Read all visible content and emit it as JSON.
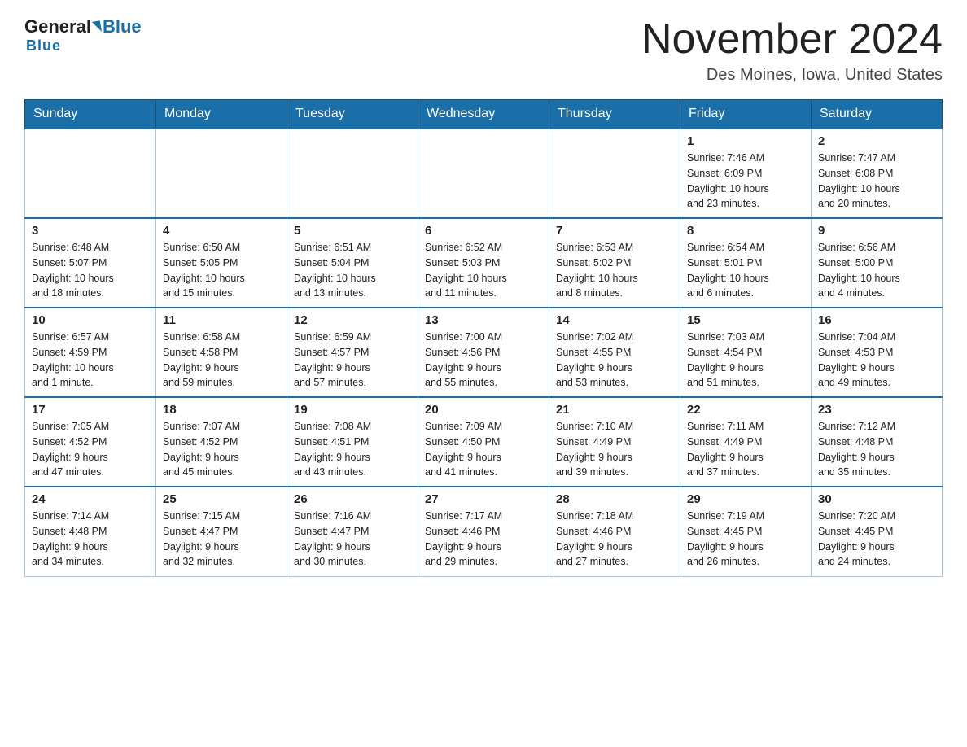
{
  "header": {
    "logo_general": "General",
    "logo_blue": "Blue",
    "month_title": "November 2024",
    "location": "Des Moines, Iowa, United States"
  },
  "days_of_week": [
    "Sunday",
    "Monday",
    "Tuesday",
    "Wednesday",
    "Thursday",
    "Friday",
    "Saturday"
  ],
  "weeks": [
    {
      "days": [
        {
          "number": "",
          "info": ""
        },
        {
          "number": "",
          "info": ""
        },
        {
          "number": "",
          "info": ""
        },
        {
          "number": "",
          "info": ""
        },
        {
          "number": "",
          "info": ""
        },
        {
          "number": "1",
          "info": "Sunrise: 7:46 AM\nSunset: 6:09 PM\nDaylight: 10 hours\nand 23 minutes."
        },
        {
          "number": "2",
          "info": "Sunrise: 7:47 AM\nSunset: 6:08 PM\nDaylight: 10 hours\nand 20 minutes."
        }
      ]
    },
    {
      "days": [
        {
          "number": "3",
          "info": "Sunrise: 6:48 AM\nSunset: 5:07 PM\nDaylight: 10 hours\nand 18 minutes."
        },
        {
          "number": "4",
          "info": "Sunrise: 6:50 AM\nSunset: 5:05 PM\nDaylight: 10 hours\nand 15 minutes."
        },
        {
          "number": "5",
          "info": "Sunrise: 6:51 AM\nSunset: 5:04 PM\nDaylight: 10 hours\nand 13 minutes."
        },
        {
          "number": "6",
          "info": "Sunrise: 6:52 AM\nSunset: 5:03 PM\nDaylight: 10 hours\nand 11 minutes."
        },
        {
          "number": "7",
          "info": "Sunrise: 6:53 AM\nSunset: 5:02 PM\nDaylight: 10 hours\nand 8 minutes."
        },
        {
          "number": "8",
          "info": "Sunrise: 6:54 AM\nSunset: 5:01 PM\nDaylight: 10 hours\nand 6 minutes."
        },
        {
          "number": "9",
          "info": "Sunrise: 6:56 AM\nSunset: 5:00 PM\nDaylight: 10 hours\nand 4 minutes."
        }
      ]
    },
    {
      "days": [
        {
          "number": "10",
          "info": "Sunrise: 6:57 AM\nSunset: 4:59 PM\nDaylight: 10 hours\nand 1 minute."
        },
        {
          "number": "11",
          "info": "Sunrise: 6:58 AM\nSunset: 4:58 PM\nDaylight: 9 hours\nand 59 minutes."
        },
        {
          "number": "12",
          "info": "Sunrise: 6:59 AM\nSunset: 4:57 PM\nDaylight: 9 hours\nand 57 minutes."
        },
        {
          "number": "13",
          "info": "Sunrise: 7:00 AM\nSunset: 4:56 PM\nDaylight: 9 hours\nand 55 minutes."
        },
        {
          "number": "14",
          "info": "Sunrise: 7:02 AM\nSunset: 4:55 PM\nDaylight: 9 hours\nand 53 minutes."
        },
        {
          "number": "15",
          "info": "Sunrise: 7:03 AM\nSunset: 4:54 PM\nDaylight: 9 hours\nand 51 minutes."
        },
        {
          "number": "16",
          "info": "Sunrise: 7:04 AM\nSunset: 4:53 PM\nDaylight: 9 hours\nand 49 minutes."
        }
      ]
    },
    {
      "days": [
        {
          "number": "17",
          "info": "Sunrise: 7:05 AM\nSunset: 4:52 PM\nDaylight: 9 hours\nand 47 minutes."
        },
        {
          "number": "18",
          "info": "Sunrise: 7:07 AM\nSunset: 4:52 PM\nDaylight: 9 hours\nand 45 minutes."
        },
        {
          "number": "19",
          "info": "Sunrise: 7:08 AM\nSunset: 4:51 PM\nDaylight: 9 hours\nand 43 minutes."
        },
        {
          "number": "20",
          "info": "Sunrise: 7:09 AM\nSunset: 4:50 PM\nDaylight: 9 hours\nand 41 minutes."
        },
        {
          "number": "21",
          "info": "Sunrise: 7:10 AM\nSunset: 4:49 PM\nDaylight: 9 hours\nand 39 minutes."
        },
        {
          "number": "22",
          "info": "Sunrise: 7:11 AM\nSunset: 4:49 PM\nDaylight: 9 hours\nand 37 minutes."
        },
        {
          "number": "23",
          "info": "Sunrise: 7:12 AM\nSunset: 4:48 PM\nDaylight: 9 hours\nand 35 minutes."
        }
      ]
    },
    {
      "days": [
        {
          "number": "24",
          "info": "Sunrise: 7:14 AM\nSunset: 4:48 PM\nDaylight: 9 hours\nand 34 minutes."
        },
        {
          "number": "25",
          "info": "Sunrise: 7:15 AM\nSunset: 4:47 PM\nDaylight: 9 hours\nand 32 minutes."
        },
        {
          "number": "26",
          "info": "Sunrise: 7:16 AM\nSunset: 4:47 PM\nDaylight: 9 hours\nand 30 minutes."
        },
        {
          "number": "27",
          "info": "Sunrise: 7:17 AM\nSunset: 4:46 PM\nDaylight: 9 hours\nand 29 minutes."
        },
        {
          "number": "28",
          "info": "Sunrise: 7:18 AM\nSunset: 4:46 PM\nDaylight: 9 hours\nand 27 minutes."
        },
        {
          "number": "29",
          "info": "Sunrise: 7:19 AM\nSunset: 4:45 PM\nDaylight: 9 hours\nand 26 minutes."
        },
        {
          "number": "30",
          "info": "Sunrise: 7:20 AM\nSunset: 4:45 PM\nDaylight: 9 hours\nand 24 minutes."
        }
      ]
    }
  ]
}
